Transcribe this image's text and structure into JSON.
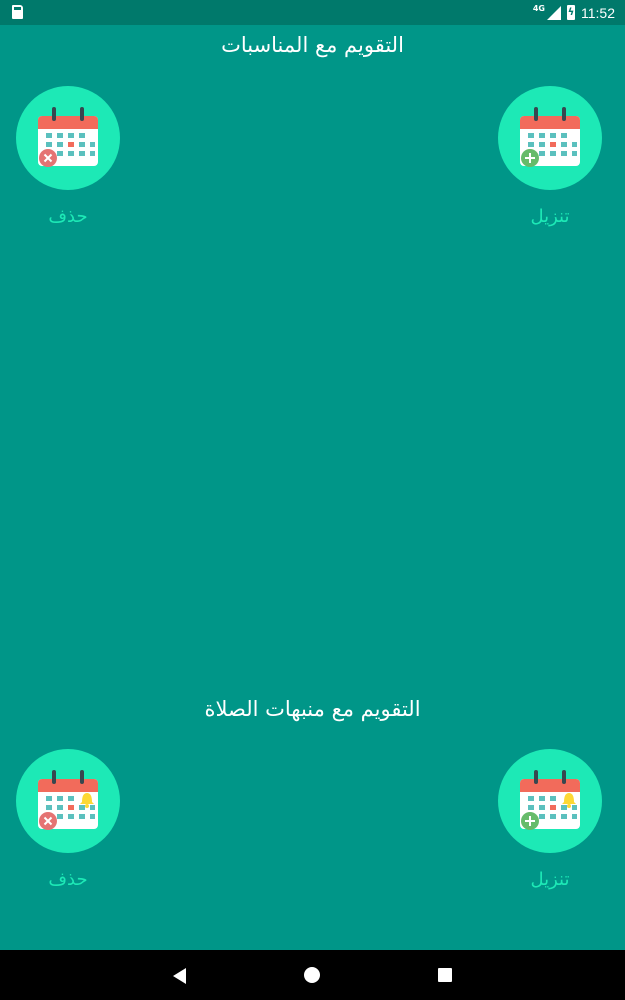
{
  "status_bar": {
    "network": "4G",
    "time": "11:52"
  },
  "sections": [
    {
      "title": "التقويم مع المناسبات",
      "download_label": "تنزيل",
      "delete_label": "حذف",
      "variant": "events"
    },
    {
      "title": "التقويم مع منبهات الصلاة",
      "download_label": "تنزيل",
      "delete_label": "حذف",
      "variant": "prayer-alarms"
    }
  ],
  "colors": {
    "background": "#009688",
    "status_bar": "#00796b",
    "accent_circle": "#1de9b6",
    "calendar_header": "#f26b5b",
    "calendar_cell": "#5bc0be",
    "add_badge": "#66bb6a",
    "remove_badge": "#e57373",
    "bell": "#fdd835"
  },
  "icons": {
    "download": "calendar-add-icon",
    "delete": "calendar-remove-icon",
    "alarm_download": "calendar-bell-add-icon",
    "alarm_delete": "calendar-bell-remove-icon"
  }
}
